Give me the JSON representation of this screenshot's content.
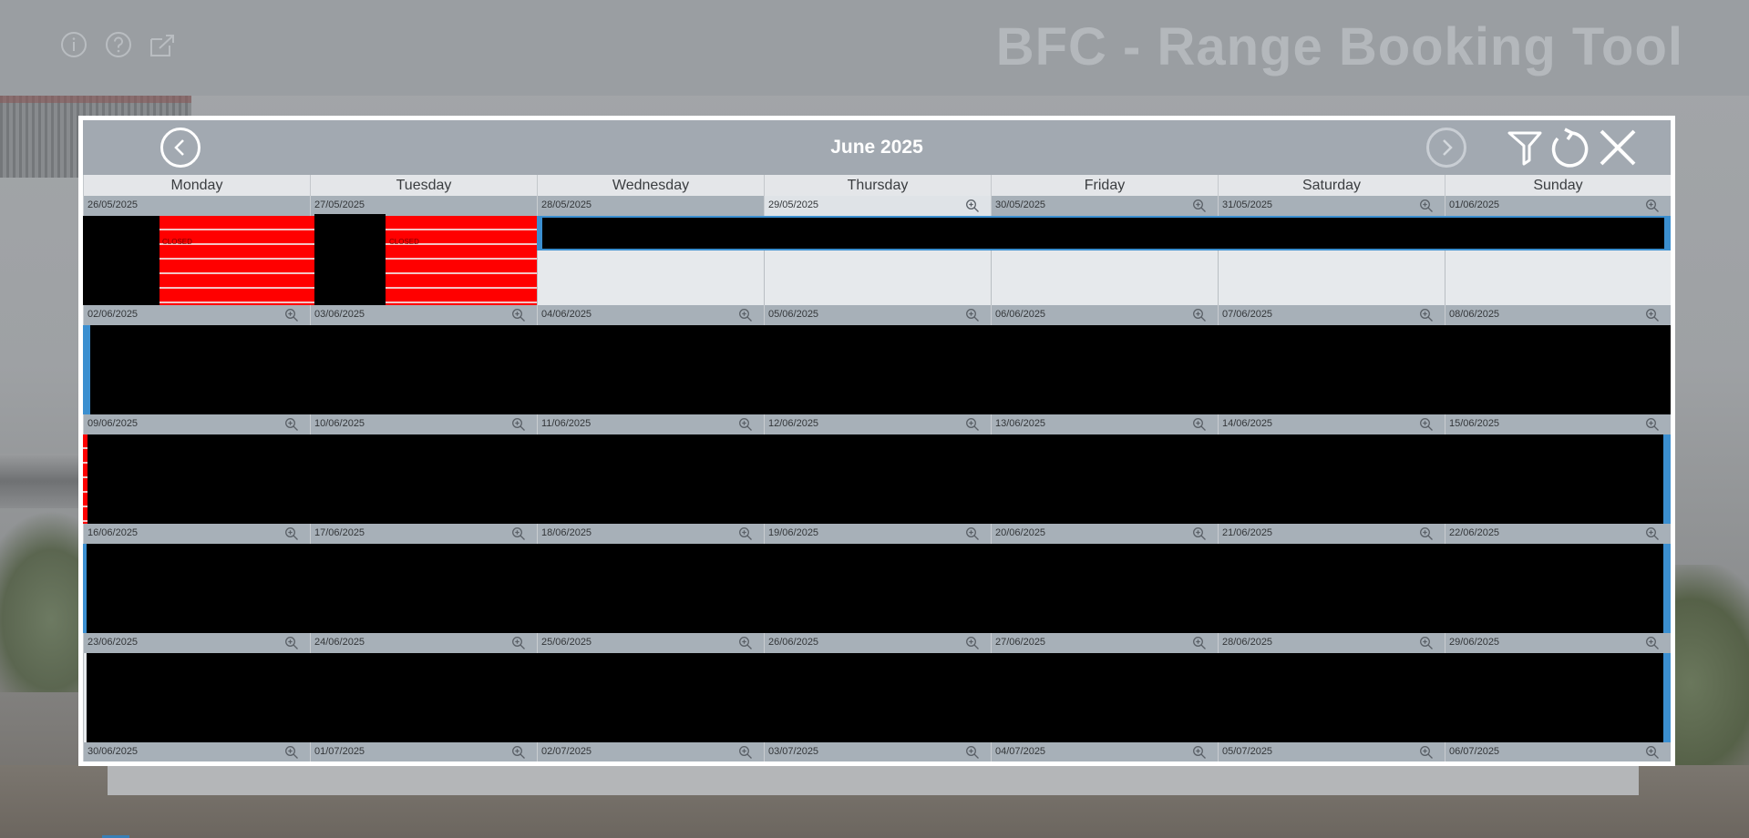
{
  "app": {
    "title": "BFC - Range Booking Tool",
    "icons": [
      "info-icon",
      "help-icon",
      "external-link-icon"
    ]
  },
  "calendar": {
    "month_title": "June 2025",
    "weekdays": [
      "Monday",
      "Tuesday",
      "Wednesday",
      "Thursday",
      "Friday",
      "Saturday",
      "Sunday"
    ],
    "weeks": [
      [
        "26/05/2025",
        "27/05/2025",
        "28/05/2025",
        "29/05/2025",
        "30/05/2025",
        "31/05/2025",
        "01/06/2025"
      ],
      [
        "02/06/2025",
        "03/06/2025",
        "04/06/2025",
        "05/06/2025",
        "06/06/2025",
        "07/06/2025",
        "08/06/2025"
      ],
      [
        "09/06/2025",
        "10/06/2025",
        "11/06/2025",
        "12/06/2025",
        "13/06/2025",
        "14/06/2025",
        "15/06/2025"
      ],
      [
        "16/06/2025",
        "17/06/2025",
        "18/06/2025",
        "19/06/2025",
        "20/06/2025",
        "21/06/2025",
        "22/06/2025"
      ],
      [
        "23/06/2025",
        "24/06/2025",
        "25/06/2025",
        "26/06/2025",
        "27/06/2025",
        "28/06/2025",
        "29/06/2025"
      ],
      [
        "30/06/2025",
        "01/07/2025",
        "02/07/2025",
        "03/07/2025",
        "04/07/2025",
        "05/07/2025",
        "06/07/2025"
      ]
    ],
    "closed_label": "CLOSED",
    "colors": {
      "closed": "#ff0000",
      "booking_edge": "#3b8fd0",
      "redacted": "#000000"
    }
  }
}
